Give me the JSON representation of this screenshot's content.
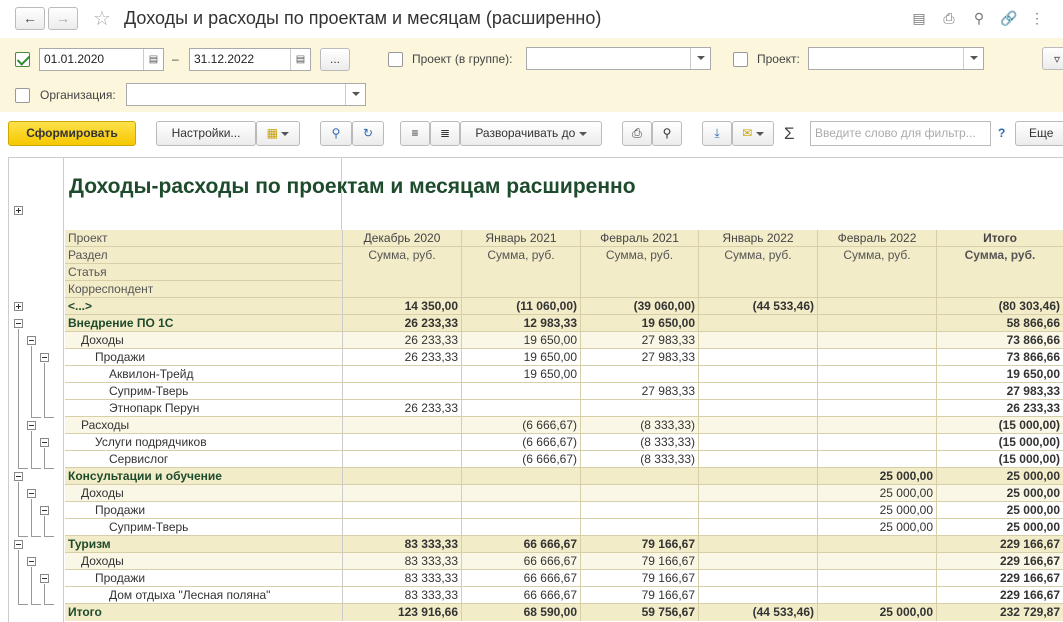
{
  "window": {
    "title": "Доходы и расходы по проектам и месяцам (расширенно)"
  },
  "filters": {
    "date_from": "01.01.2020",
    "date_sep": "–",
    "date_to": "31.12.2022",
    "more_btn": "...",
    "project_group_label": "Проект (в группе):",
    "project_label": "Проект:",
    "org_label": "Организация:"
  },
  "toolbar": {
    "generate": "Сформировать",
    "settings": "Настройки...",
    "expand_to": "Разворачивать до",
    "sum_icon": "Σ",
    "search_placeholder": "Введите слово для фильтр...",
    "help": "?",
    "more": "Еще"
  },
  "report": {
    "title": "Доходы-расходы по проектам и месяцам расширенно",
    "dim_headers": [
      "Проект",
      "Раздел",
      "Статья",
      "Корреспондент"
    ],
    "columns": [
      "Декабрь 2020",
      "Январь 2021",
      "Февраль 2021",
      "Январь 2022",
      "Февраль 2022",
      "Итого"
    ],
    "subheader": [
      "Сумма, руб.",
      "Сумма, руб.",
      "Сумма, руб.",
      "Сумма, руб.",
      "Сумма, руб.",
      "Сумма, руб."
    ],
    "rows": [
      {
        "label": "<...>",
        "level": 0,
        "bold": true,
        "vals": [
          "14 350,00",
          "(11 060,00)",
          "(39 060,00)",
          "(44 533,46)",
          "",
          "(80 303,46)"
        ]
      },
      {
        "label": "Внедрение ПО 1С",
        "level": 0,
        "bold": true,
        "vals": [
          "26 233,33",
          "12 983,33",
          "19 650,00",
          "",
          "",
          "58 866,66"
        ]
      },
      {
        "label": "Доходы",
        "level": 1,
        "bold": false,
        "vals": [
          "26 233,33",
          "19 650,00",
          "27 983,33",
          "",
          "",
          "73 866,66"
        ]
      },
      {
        "label": "Продажи",
        "level": 2,
        "bold": false,
        "vals": [
          "26 233,33",
          "19 650,00",
          "27 983,33",
          "",
          "",
          "73 866,66"
        ]
      },
      {
        "label": "Аквилон-Трейд",
        "level": 3,
        "bold": false,
        "vals": [
          "",
          "19 650,00",
          "",
          "",
          "",
          "19 650,00"
        ]
      },
      {
        "label": "Суприм-Тверь",
        "level": 3,
        "bold": false,
        "vals": [
          "",
          "",
          "27 983,33",
          "",
          "",
          "27 983,33"
        ]
      },
      {
        "label": "Этнопарк Перун",
        "level": 3,
        "bold": false,
        "vals": [
          "26 233,33",
          "",
          "",
          "",
          "",
          "26 233,33"
        ]
      },
      {
        "label": "Расходы",
        "level": 1,
        "bold": false,
        "vals": [
          "",
          "(6 666,67)",
          "(8 333,33)",
          "",
          "",
          "(15 000,00)"
        ]
      },
      {
        "label": "Услуги подрядчиков",
        "level": 2,
        "bold": false,
        "vals": [
          "",
          "(6 666,67)",
          "(8 333,33)",
          "",
          "",
          "(15 000,00)"
        ]
      },
      {
        "label": "Сервислог",
        "level": 3,
        "bold": false,
        "vals": [
          "",
          "(6 666,67)",
          "(8 333,33)",
          "",
          "",
          "(15 000,00)"
        ]
      },
      {
        "label": "Консультации и обучение",
        "level": 0,
        "bold": true,
        "vals": [
          "",
          "",
          "",
          "",
          "25 000,00",
          "25 000,00"
        ]
      },
      {
        "label": "Доходы",
        "level": 1,
        "bold": false,
        "vals": [
          "",
          "",
          "",
          "",
          "25 000,00",
          "25 000,00"
        ]
      },
      {
        "label": "Продажи",
        "level": 2,
        "bold": false,
        "vals": [
          "",
          "",
          "",
          "",
          "25 000,00",
          "25 000,00"
        ]
      },
      {
        "label": "Суприм-Тверь",
        "level": 3,
        "bold": false,
        "vals": [
          "",
          "",
          "",
          "",
          "25 000,00",
          "25 000,00"
        ]
      },
      {
        "label": "Туризм",
        "level": 0,
        "bold": true,
        "vals": [
          "83 333,33",
          "66 666,67",
          "79 166,67",
          "",
          "",
          "229 166,67"
        ]
      },
      {
        "label": "Доходы",
        "level": 1,
        "bold": false,
        "vals": [
          "83 333,33",
          "66 666,67",
          "79 166,67",
          "",
          "",
          "229 166,67"
        ]
      },
      {
        "label": "Продажи",
        "level": 2,
        "bold": false,
        "vals": [
          "83 333,33",
          "66 666,67",
          "79 166,67",
          "",
          "",
          "229 166,67"
        ]
      },
      {
        "label": "Дом отдыха \"Лесная поляна\"",
        "level": 3,
        "bold": false,
        "vals": [
          "83 333,33",
          "66 666,67",
          "79 166,67",
          "",
          "",
          "229 166,67"
        ]
      }
    ],
    "total": {
      "label": "Итого",
      "vals": [
        "123 916,66",
        "68 590,00",
        "59 756,67",
        "(44 533,46)",
        "25 000,00",
        "232 729,87"
      ]
    }
  }
}
